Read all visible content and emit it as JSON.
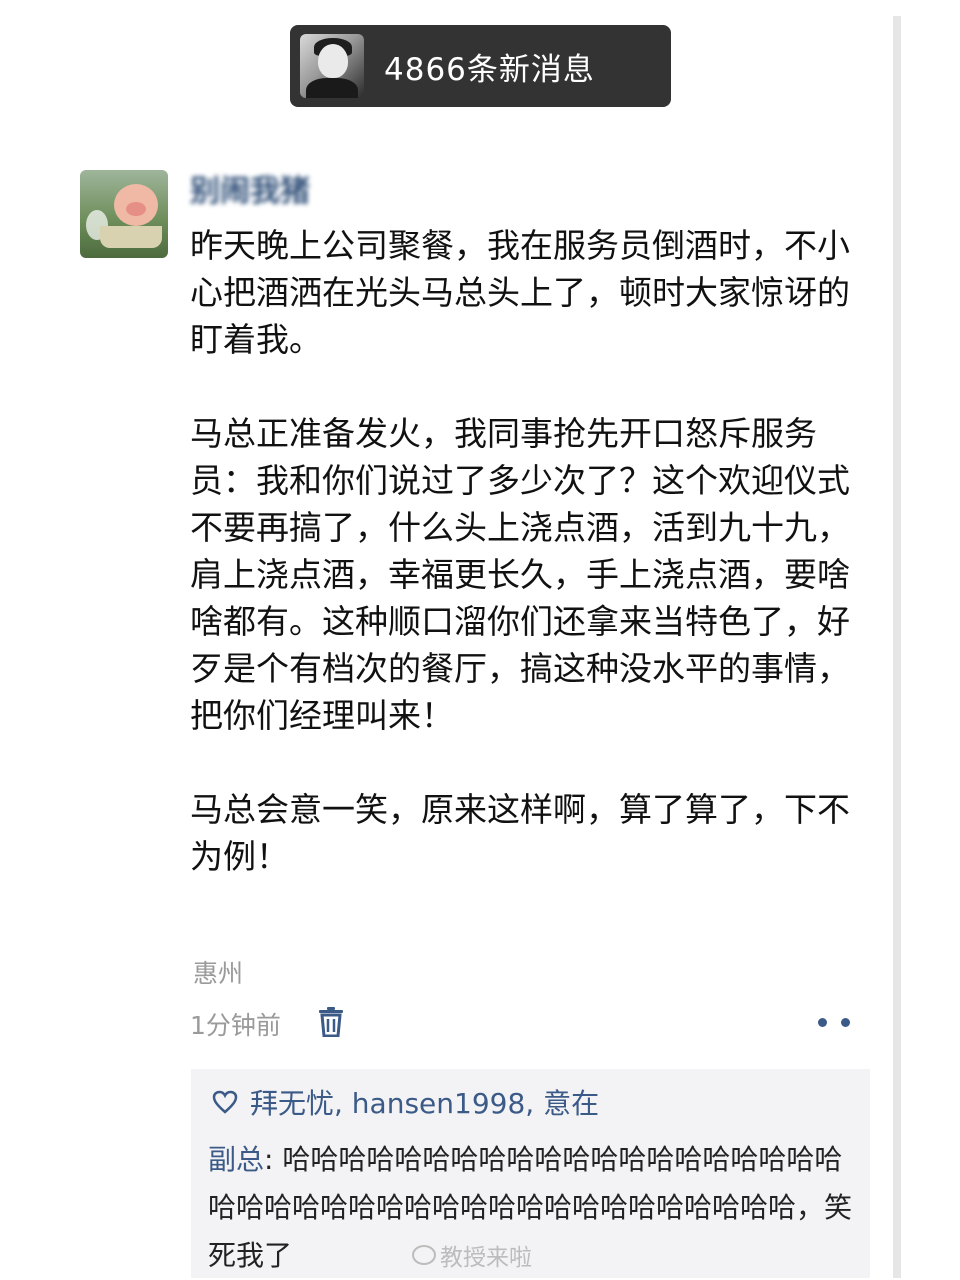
{
  "notification": {
    "text": "4866条新消息"
  },
  "post": {
    "username": "别闹我猪",
    "paragraphs": [
      "昨天晚上公司聚餐，我在服务员倒酒时，不小心把酒洒在光头马总头上了，顿时大家惊讶的盯着我。",
      "马总正准备发火，我同事抢先开口怒斥服务员：我和你们说过了多少次了？这个欢迎仪式不要再搞了，什么头上浇点酒，活到九十九，肩上浇点酒，幸福更长久，手上浇点酒，要啥啥都有。这种顺口溜你们还拿来当特色了，好歹是个有档次的餐厅，搞这种没水平的事情，把你们经理叫来！",
      "马总会意一笑，原来这样啊，算了算了，下不为例！"
    ],
    "location": "惠州",
    "time": "1分钟前"
  },
  "likes": {
    "names": "拜无忧, hansen1998, 意在"
  },
  "comment": {
    "author": "副总",
    "separator": ": ",
    "text": "哈哈哈哈哈哈哈哈哈哈哈哈哈哈哈哈哈哈哈哈哈哈哈哈哈哈哈哈哈哈哈哈哈哈哈哈哈哈哈哈哈，笑死我了"
  },
  "watermark": {
    "text": "教授来啦"
  },
  "colors": {
    "link": "#3b5a87",
    "muted": "#9a9a9a",
    "comment_bg": "#f3f3f5",
    "notice_bg": "#333333"
  }
}
